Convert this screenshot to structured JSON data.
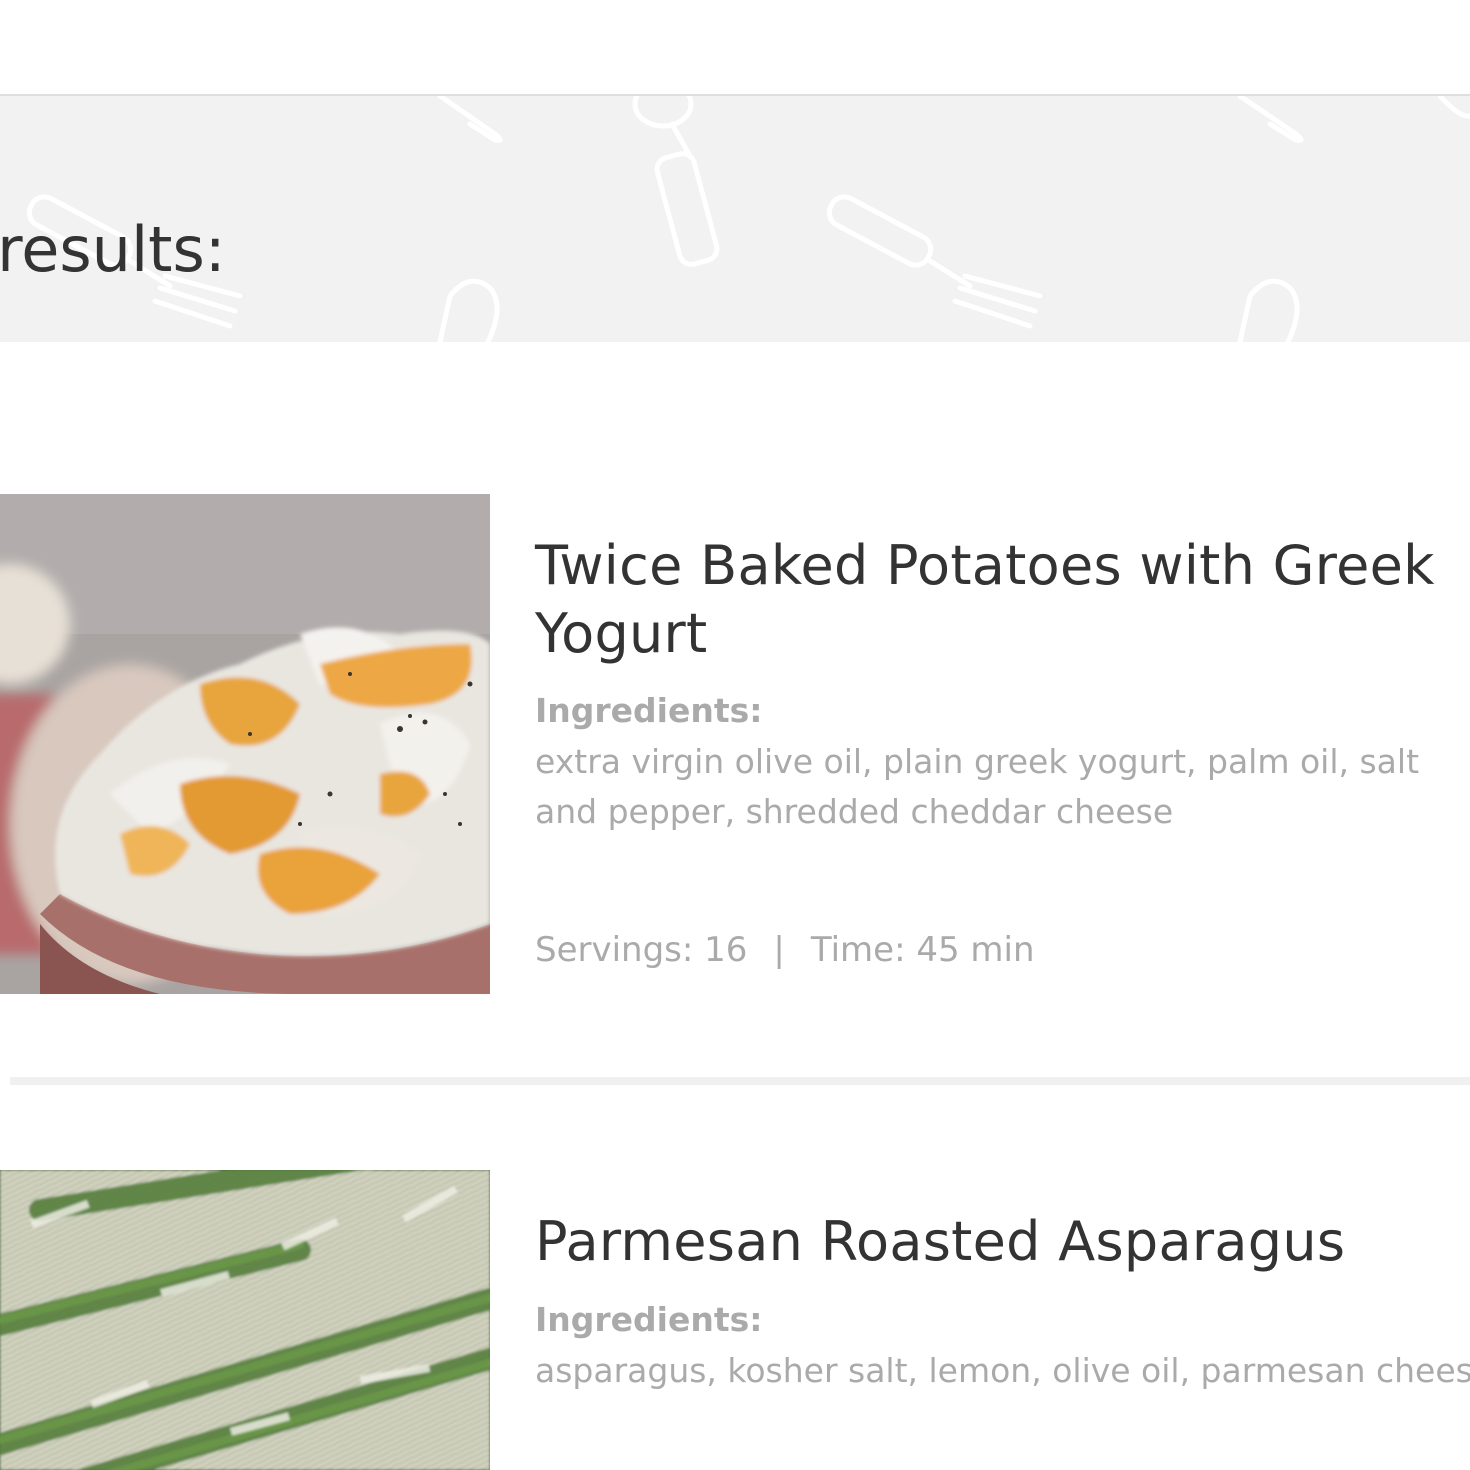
{
  "banner": {
    "title": "ch results:"
  },
  "results": [
    {
      "title": "Twice Baked Potatoes with Greek Yogurt",
      "ingredients_label": "Ingredients:",
      "ingredients": "extra virgin olive oil, plain greek yogurt, palm oil, salt and pepper, shredded cheddar cheese",
      "servings": "Servings: 16",
      "separator": "|",
      "time": "Time: 45 min",
      "image": "twice-baked-potato-photo"
    },
    {
      "title": "Parmesan Roasted Asparagus",
      "ingredients_label": "Ingredients:",
      "ingredients": "asparagus, kosher salt, lemon, olive oil, parmesan cheese",
      "image": "parmesan-asparagus-photo"
    }
  ],
  "colors": {
    "banner_bg": "#f2f2f2",
    "title_text": "#333333",
    "muted_text": "#aaaaaa",
    "divider": "#f0f0f0"
  }
}
